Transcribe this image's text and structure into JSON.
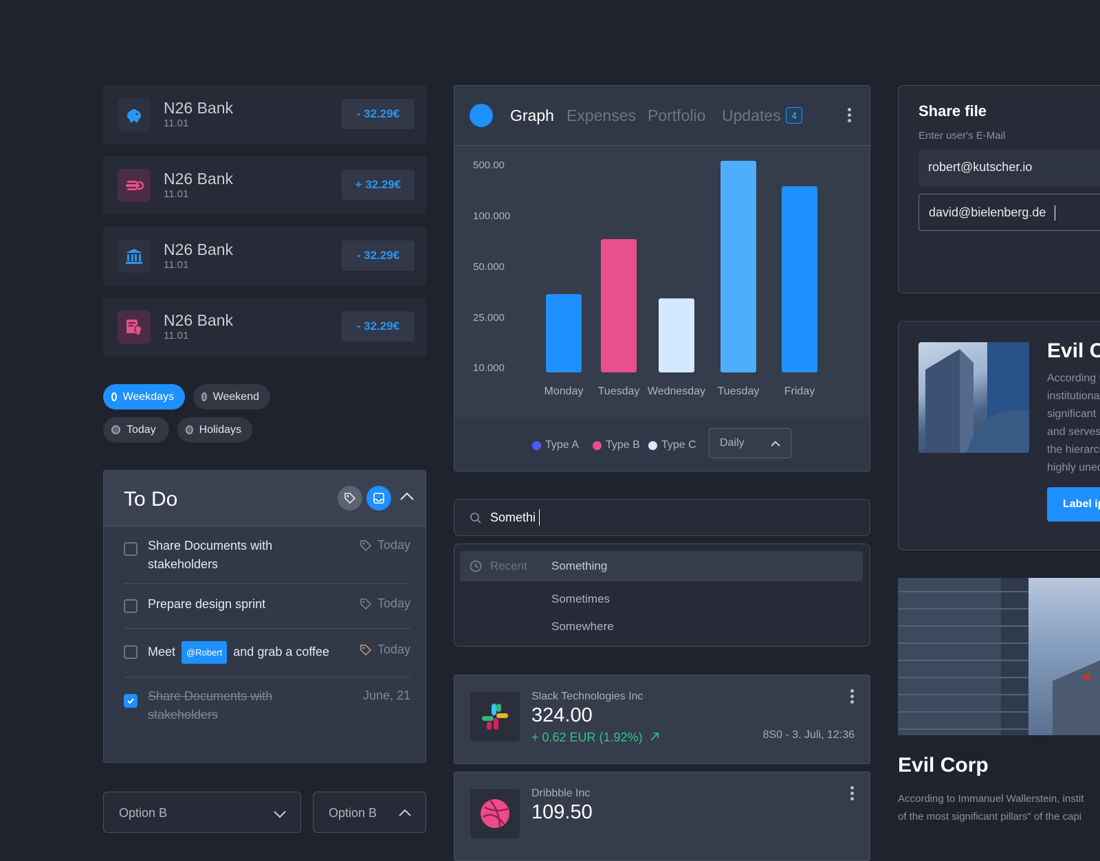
{
  "colors": {
    "background": "#1f232d",
    "accent": "#1e90ff",
    "pink": "#e84f8c",
    "green": "#30c58a"
  },
  "bank_cards": [
    {
      "icon": "piggy-bank-icon",
      "name": "N26 Bank",
      "date": "11.01",
      "amount": "- 32.29€"
    },
    {
      "icon": "hand-coin-icon",
      "name": "N26 Bank",
      "date": "11.01",
      "amount": "+ 32.29€"
    },
    {
      "icon": "bank-building-icon",
      "name": "N26 Bank",
      "date": "11.01",
      "amount": "- 32.29€"
    },
    {
      "icon": "certificate-icon",
      "name": "N26 Bank",
      "date": "11.01",
      "amount": "- 32.29€"
    }
  ],
  "filters": [
    {
      "label": "Weekdays",
      "selected": true
    },
    {
      "label": "Weekend",
      "selected": false
    },
    {
      "label": "Today",
      "selected": false
    },
    {
      "label": "Holidays",
      "selected": false
    }
  ],
  "todo": {
    "title": "To Do",
    "items": [
      {
        "text_line1": "Share Documents with",
        "text_line2": "stakeholders",
        "tag": "Today",
        "checked": false
      },
      {
        "text": "Prepare design sprint",
        "tag": "Today",
        "checked": false
      },
      {
        "text_before": "Meet",
        "mention": "@Robert",
        "text_after": "and grab a coffee",
        "tag": "Today",
        "checked": false
      },
      {
        "text_line1": "Share Documents with",
        "text_line2": "stakeholders",
        "tag": "June, 21",
        "checked": true
      }
    ]
  },
  "selects": [
    {
      "value": "Option B",
      "open": false
    },
    {
      "value": "Option B",
      "open": true
    }
  ],
  "chart_panel": {
    "tabs": [
      "Graph",
      "Expenses",
      "Portfolio",
      "Updates"
    ],
    "active_tab": "Graph",
    "updates_badge": "4",
    "period_select": "Daily",
    "legend": [
      {
        "label": "Type A",
        "color": "#4a5cf5"
      },
      {
        "label": "Type B",
        "color": "#e84f8c"
      },
      {
        "label": "Type C",
        "color": "#d4e9ff"
      }
    ]
  },
  "chart_data": {
    "type": "bar",
    "categories": [
      "Monday",
      "Tuesday",
      "Wednesday",
      "Tuesday",
      "Friday"
    ],
    "values": [
      24000,
      62000,
      23000,
      600,
      170000
    ],
    "tick_labels": [
      "500.00",
      "100.000",
      "50.000",
      "25.000",
      "10.000"
    ],
    "bar_colors": [
      "#1e90ff",
      "#e84f8c",
      "#d4e9ff",
      "#4faefc",
      "#1e90ff"
    ],
    "title": "",
    "xlabel": "",
    "ylabel": "",
    "bar_levels": [
      0.37,
      0.63,
      0.35,
      1.0,
      0.88
    ],
    "grid": false
  },
  "search": {
    "value": "Somethi",
    "recent_label": "Recent",
    "suggestions": [
      "Something",
      "Sometimes",
      "Somewhere"
    ]
  },
  "stocks": [
    {
      "name": "Slack Technologies Inc",
      "price": "324.00",
      "change": "+ 0.62 EUR (1.92%)",
      "meta": "8S0 - 3. Juli, 12:36",
      "logo": "slack-logo-icon"
    },
    {
      "name": "Dribbble Inc",
      "price": "109.50",
      "logo": "dribbble-logo-icon"
    }
  ],
  "share": {
    "title": "Share file",
    "label": "Enter user's E-Mail",
    "emails": [
      "robert@kutscher.io",
      "david@bielenberg.de"
    ]
  },
  "evil_card": {
    "title": "Evil Co",
    "lines": [
      "According t",
      "institutiona",
      "significant",
      "and serves",
      "the hierarch",
      "highly uneq"
    ],
    "button": "Label ip"
  },
  "evil_corp": {
    "title": "Evil Corp",
    "line1": "According to Immanuel Wallerstein, instit",
    "line2": "of the most significant pillars\" of the capi"
  }
}
